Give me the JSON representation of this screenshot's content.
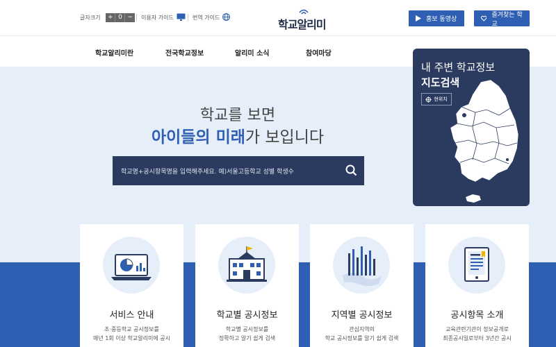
{
  "utility": {
    "font_size_label": "글자크기",
    "font_size_buttons": [
      "+",
      "0",
      "−"
    ],
    "user_guide": "이용자 가이드",
    "translation_guide": "번역 가이드"
  },
  "logo": {
    "text": "학교알리미"
  },
  "cta": {
    "promo_video": "홍보 동영상",
    "favorite_school": "즐겨찾는 학교"
  },
  "nav": {
    "items": [
      "학교알리미란",
      "전국학교정보",
      "알리미 소식",
      "참여마당"
    ]
  },
  "hero": {
    "line1": "학교를 보면",
    "line2_highlight": "아이들의 미래",
    "line2_rest": "가 보입니다",
    "search_placeholder": "학교명+공시항목명을 입력해주세요. 예)서울고등학교 성별 학생수"
  },
  "map_card": {
    "line1": "내 주변 학교정보",
    "line2": "지도검색",
    "locate_label": "현위치"
  },
  "cards": [
    {
      "title": "서비스 안내",
      "desc1": "초·중등학교 공시정보를",
      "desc2": "매년 1회 이상 학교알리미에 공시"
    },
    {
      "title": "학교별 공시정보",
      "desc1": "학교별 공시정보를",
      "desc2": "정확하고 알기 쉽게 검색"
    },
    {
      "title": "지역별 공시정보",
      "desc1": "관심지역의",
      "desc2": "학교 공시정보를 알기 쉽게 검색"
    },
    {
      "title": "공시항목 소개",
      "desc1": "교육관련기관이 정보공개로",
      "desc2": "최종공시일로부터 3년간 공시"
    }
  ],
  "colors": {
    "brand_blue": "#2f5fb3",
    "navy": "#2b3a5f",
    "hero_bg": "#e6eef9"
  },
  "icons": [
    "monitor-icon",
    "globe-icon",
    "play-icon",
    "heart-icon",
    "search-icon",
    "crosshair-icon",
    "chart-monitor-icon",
    "school-building-icon",
    "bar-map-icon",
    "document-icon"
  ]
}
